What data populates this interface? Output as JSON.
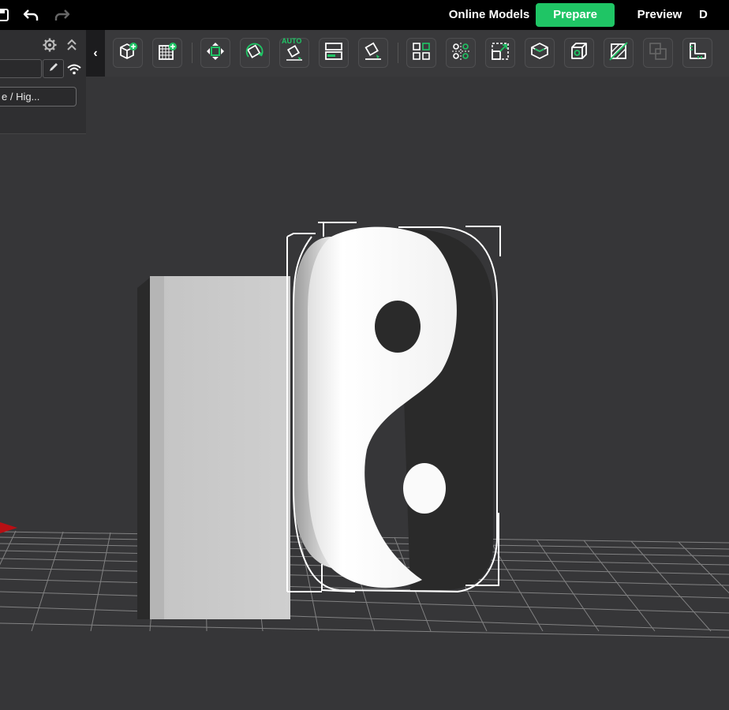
{
  "app": {
    "header": {
      "tabs": [
        {
          "label": "Online Models",
          "active": false
        },
        {
          "label": "Prepare",
          "active": true
        },
        {
          "label": "Preview",
          "active": false
        },
        {
          "label": "D",
          "active": false
        }
      ],
      "icons": [
        "save-icon",
        "undo-icon",
        "redo-icon"
      ]
    },
    "left_panel": {
      "icons": [
        "settings-gear-icon",
        "collapse-up-icon",
        "edit-pencil-icon",
        "wifi-icon"
      ],
      "printer_field": "",
      "process_preset": "e / Hig..."
    },
    "toolbar": {
      "collapse_label": "‹",
      "auto_badge": "AUTO",
      "tools": [
        "add-object",
        "add-plate",
        "arrange",
        "orient",
        "auto-orient",
        "split-plates",
        "lay-on-face",
        "split-objects",
        "split-parts",
        "scale",
        "slice-plate",
        "cut",
        "boolean",
        "assembly",
        "measure"
      ]
    },
    "colors": {
      "accent": "#1fc565",
      "background": "#363638",
      "topbar": "#000000",
      "toolbar": "#39393b"
    }
  }
}
